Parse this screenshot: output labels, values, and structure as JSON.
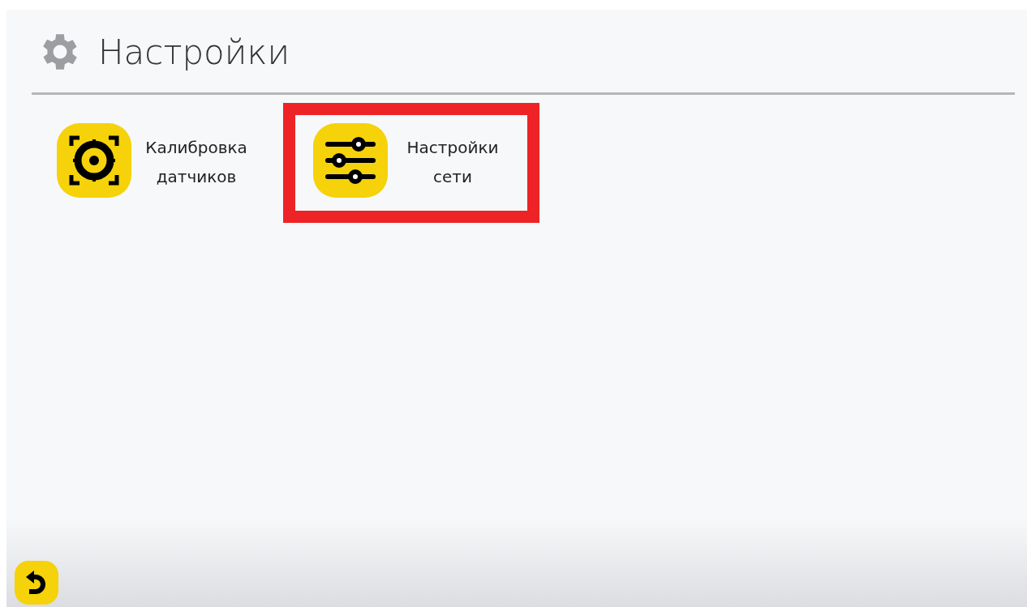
{
  "header": {
    "title": "Настройки"
  },
  "tiles": [
    {
      "kind": "target",
      "label": "Калибровка датчиков",
      "highlighted": false
    },
    {
      "kind": "sliders",
      "label": "Настройки сети",
      "highlighted": true
    }
  ],
  "footer": {
    "back_button": {
      "kind": "back"
    }
  }
}
